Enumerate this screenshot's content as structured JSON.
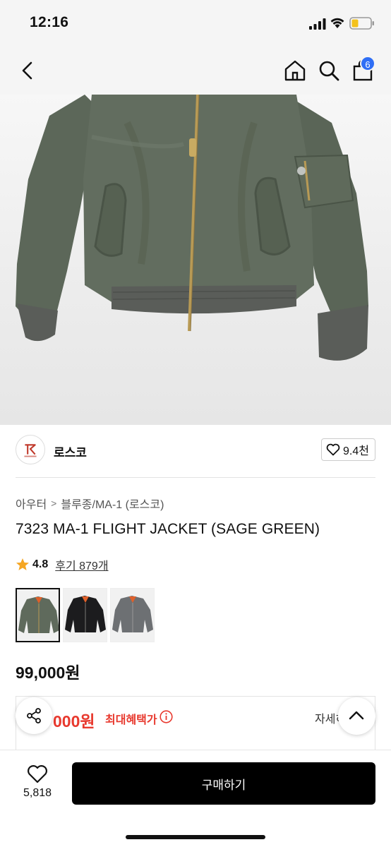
{
  "status_bar": {
    "time": "12:16"
  },
  "nav": {
    "cart_count": "6"
  },
  "brand": {
    "name": "로스코",
    "likes": "9.4천"
  },
  "breadcrumb": {
    "category": "아우터",
    "separator": ">",
    "subcategory": "블루종/MA-1 (로스코)"
  },
  "product": {
    "title": "7323 MA-1 FLIGHT JACKET (SAGE GREEN)",
    "rating": "4.8",
    "reviews": "후기 879개",
    "price": "99,000원",
    "thumbnails": [
      {
        "name": "sage green",
        "color": "#5f6a5c",
        "selected": true
      },
      {
        "name": "black",
        "color": "#1c1c1e",
        "selected": false
      },
      {
        "name": "grey",
        "color": "#6d7073",
        "selected": false
      }
    ]
  },
  "benefit": {
    "price": "000원",
    "label": "최대혜택가",
    "detail": "자세히"
  },
  "bottom": {
    "wish_count": "5,818",
    "buy_label": "구매하기"
  },
  "colors": {
    "accent_red": "#e8392e",
    "badge_blue": "#2f6ef5",
    "jacket_green": "#5f6a5c",
    "lining_orange": "#e0602a"
  }
}
